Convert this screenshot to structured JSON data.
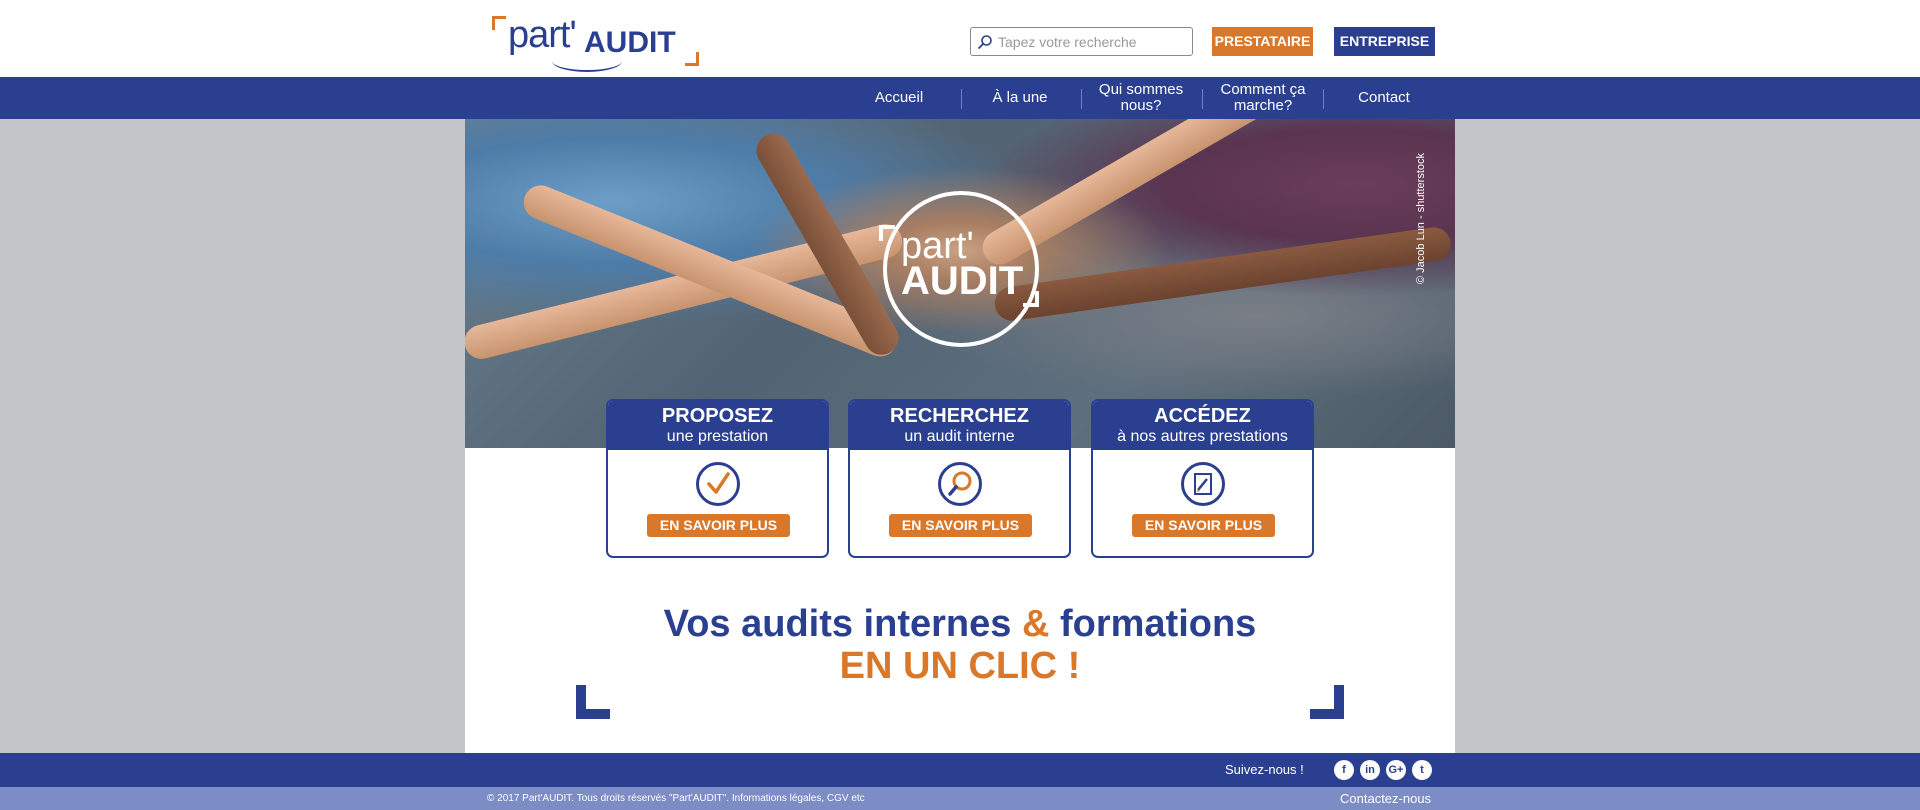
{
  "header": {
    "logo_word1": "part'",
    "logo_word2": "AUDIT",
    "search_placeholder": "Tapez votre recherche",
    "btn_prestataire": "PRESTATAIRE",
    "btn_entreprise": "ENTREPRISE"
  },
  "nav": {
    "items": [
      {
        "label": "Accueil"
      },
      {
        "label": "À la une"
      },
      {
        "label": "Qui sommes nous?"
      },
      {
        "label": "Comment ça marche?"
      },
      {
        "label": "Contact"
      }
    ]
  },
  "hero": {
    "logo_word1": "part'",
    "logo_word2": "AUDIT",
    "credit": "© Jacob Lun - shutterstock"
  },
  "cards": [
    {
      "title": "PROPOSEZ",
      "subtitle": "une prestation",
      "icon": "checkmark-icon",
      "button": "EN SAVOIR PLUS"
    },
    {
      "title": "RECHERCHEZ",
      "subtitle": "un audit interne",
      "icon": "search-icon",
      "button": "EN SAVOIR PLUS"
    },
    {
      "title": "ACCÉDEZ",
      "subtitle": "à nos autres prestations",
      "icon": "edit-document-icon",
      "button": "EN SAVOIR PLUS"
    }
  ],
  "tagline": {
    "part1": "Vos audits internes ",
    "amp": "&",
    "part2": " formations",
    "line2": "EN UN CLIC !"
  },
  "footer": {
    "follow": "Suivez-nous !",
    "social": [
      "f",
      "in",
      "G+",
      "t"
    ],
    "copyright": "© 2017 Part'AUDIT. Tous droits réservés \"Part'AUDIT\". Informations légales, CGV etc",
    "contact": "Contactez-nous"
  },
  "colors": {
    "brand_blue": "#2a3f8f",
    "brand_orange": "#d9782a",
    "page_gray": "#c4c5c9"
  }
}
